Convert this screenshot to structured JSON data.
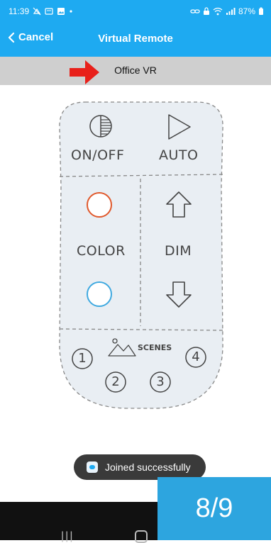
{
  "status_bar": {
    "time": "11:39",
    "battery": "87%",
    "left_icons": [
      "mute-icon",
      "message-icon",
      "gallery-icon",
      "dot-icon"
    ],
    "right_icons": [
      "link-icon",
      "lock-icon",
      "wifi-icon",
      "signal-icon",
      "battery-icon"
    ]
  },
  "header": {
    "cancel_label": "Cancel",
    "title": "Virtual Remote"
  },
  "subtitle": "Office VR",
  "remote": {
    "on_off_label": "ON/OFF",
    "auto_label": "AUTO",
    "color_label": "COLOR",
    "dim_label": "DIM",
    "scenes_label": "SCENES",
    "scene_numbers": [
      "1",
      "2",
      "3",
      "4"
    ],
    "warm_color": "#e0582b",
    "cool_color": "#3fa9e0"
  },
  "toast": {
    "text": "Joined successfully"
  },
  "page_counter": "8/9",
  "colors": {
    "accent": "#1eaaf1",
    "arrow": "#e8201a"
  }
}
